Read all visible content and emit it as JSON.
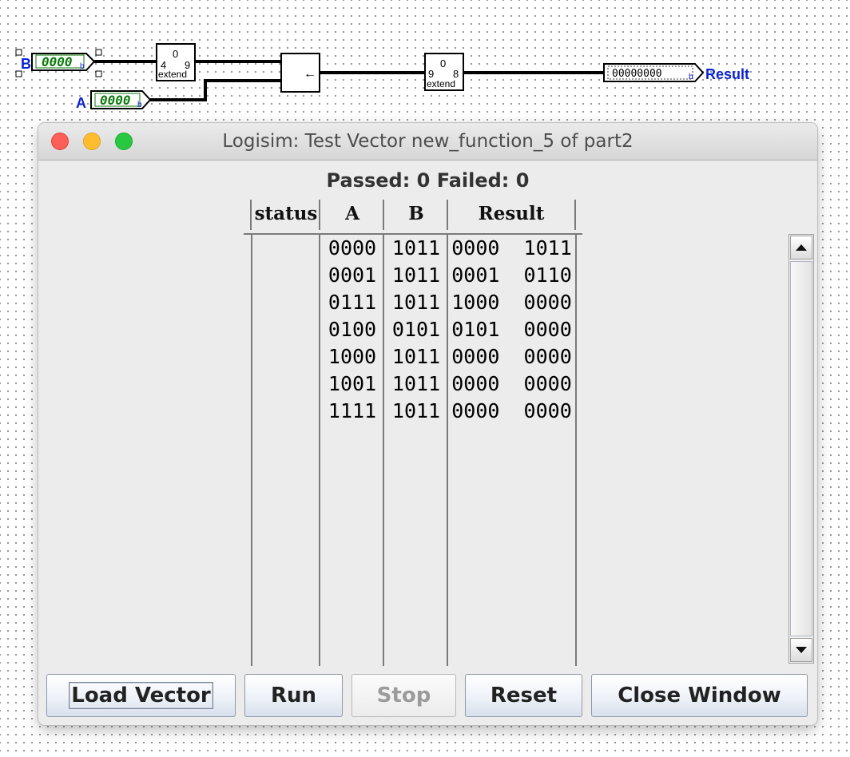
{
  "circuit": {
    "input_b": {
      "label": "B",
      "bits": "0000",
      "radix": "b"
    },
    "input_a": {
      "label": "A",
      "bits": "0000",
      "radix": "b"
    },
    "extender_left": {
      "top": "0",
      "in_width": "4",
      "out_width": "9",
      "name": "extend"
    },
    "extender_right": {
      "top": "0",
      "in_width": "9",
      "out_width": "8",
      "name": "extend"
    },
    "shifter": {
      "symbol": "←"
    },
    "output": {
      "label": "Result",
      "bits": "00000000",
      "radix": "b"
    },
    "label_color": "#0b22d6",
    "bits_color": "#0a7a0a"
  },
  "window": {
    "title": "Logisim: Test Vector new_function_5 of part2",
    "summary": "Passed: 0 Failed: 0",
    "columns": [
      "status",
      "A",
      "B",
      "Result"
    ],
    "rows": [
      {
        "status": "",
        "A": "0000",
        "B": "1011",
        "Result": "0000  1011"
      },
      {
        "status": "",
        "A": "0001",
        "B": "1011",
        "Result": "0001  0110"
      },
      {
        "status": "",
        "A": "0111",
        "B": "1011",
        "Result": "1000  0000"
      },
      {
        "status": "",
        "A": "0100",
        "B": "0101",
        "Result": "0101  0000"
      },
      {
        "status": "",
        "A": "1000",
        "B": "1011",
        "Result": "0000  0000"
      },
      {
        "status": "",
        "A": "1001",
        "B": "1011",
        "Result": "0000  0000"
      },
      {
        "status": "",
        "A": "1111",
        "B": "1011",
        "Result": "0000  0000"
      }
    ],
    "buttons": {
      "load": "Load Vector",
      "run": "Run",
      "stop": "Stop",
      "reset": "Reset",
      "close": "Close Window"
    },
    "icons": {
      "scroll_up": "triangle-up-icon",
      "scroll_down": "triangle-down-icon"
    }
  }
}
